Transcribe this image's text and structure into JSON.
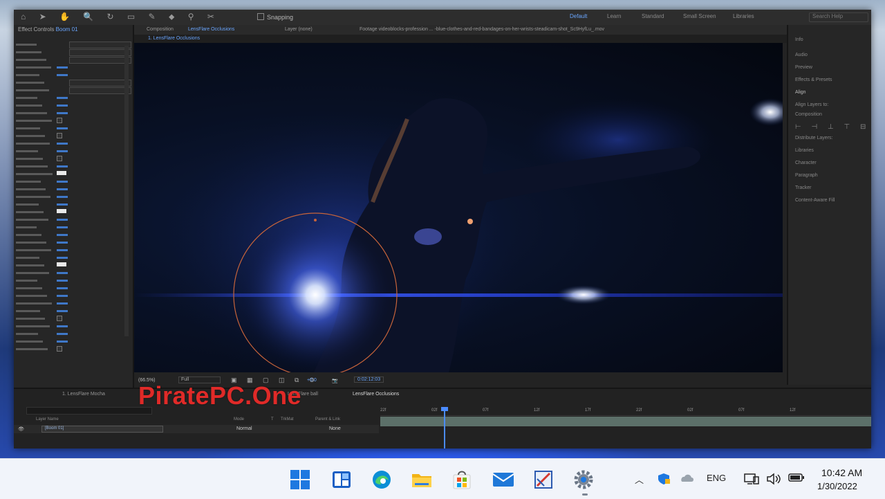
{
  "toolbar": {
    "snapping_label": "Snapping",
    "workspaces": [
      "Default",
      "Learn",
      "Standard",
      "Small Screen",
      "Libraries"
    ],
    "search_placeholder": "Search Help"
  },
  "effect_controls": {
    "tab_label": "Effect Controls",
    "tab_layer": "Boom 01"
  },
  "composition": {
    "panel_label": "Composition",
    "comp_name": "LensFlare Occlusions",
    "layer_label": "Layer (none)",
    "footage_label": "Footage videoblocks-profession ... -blue-clothes-and-red-bandages-on-her-wrists-steadicam-shot_Sc9HyfLu_.mov",
    "sub_tab": "1. LensFlare Occlusions"
  },
  "viewer_bar": {
    "magnification": "(66.5%)",
    "resolution": "Full",
    "exposure": "+0.0",
    "timecode": "0:02:12:03"
  },
  "right_panel": {
    "items": [
      "Info",
      "Audio",
      "Preview",
      "Effects & Presets",
      "Align",
      "Align Layers to:",
      "Composition",
      "Distribute Layers:",
      "Libraries",
      "Character",
      "Paragraph",
      "Tracker",
      "Content-Aware Fill"
    ]
  },
  "timeline": {
    "tabs": [
      "1. LensFlare Mocha",
      "LensFlare ball",
      "LensFlare Occlusions"
    ],
    "columns": [
      "Layer Name",
      "Mode",
      "T",
      "TrkMat",
      "Parent & Link"
    ],
    "layer": {
      "name": "[Boom 01]",
      "mode": "Normal",
      "parent": "None"
    },
    "ruler": [
      "22f",
      "02f",
      "07f",
      "12f",
      "17f",
      "22f",
      "02f",
      "07f",
      "12f"
    ]
  },
  "watermark": "PiratePC.One",
  "taskbar": {
    "language": "ENG",
    "time": "10:42 AM",
    "date": "1/30/2022"
  },
  "colors": {
    "accent_blue": "#4b8cff",
    "watermark_red": "#e02a28",
    "flare_ring": "#c8643a",
    "taskbar_bg": "#f1f4fa"
  }
}
